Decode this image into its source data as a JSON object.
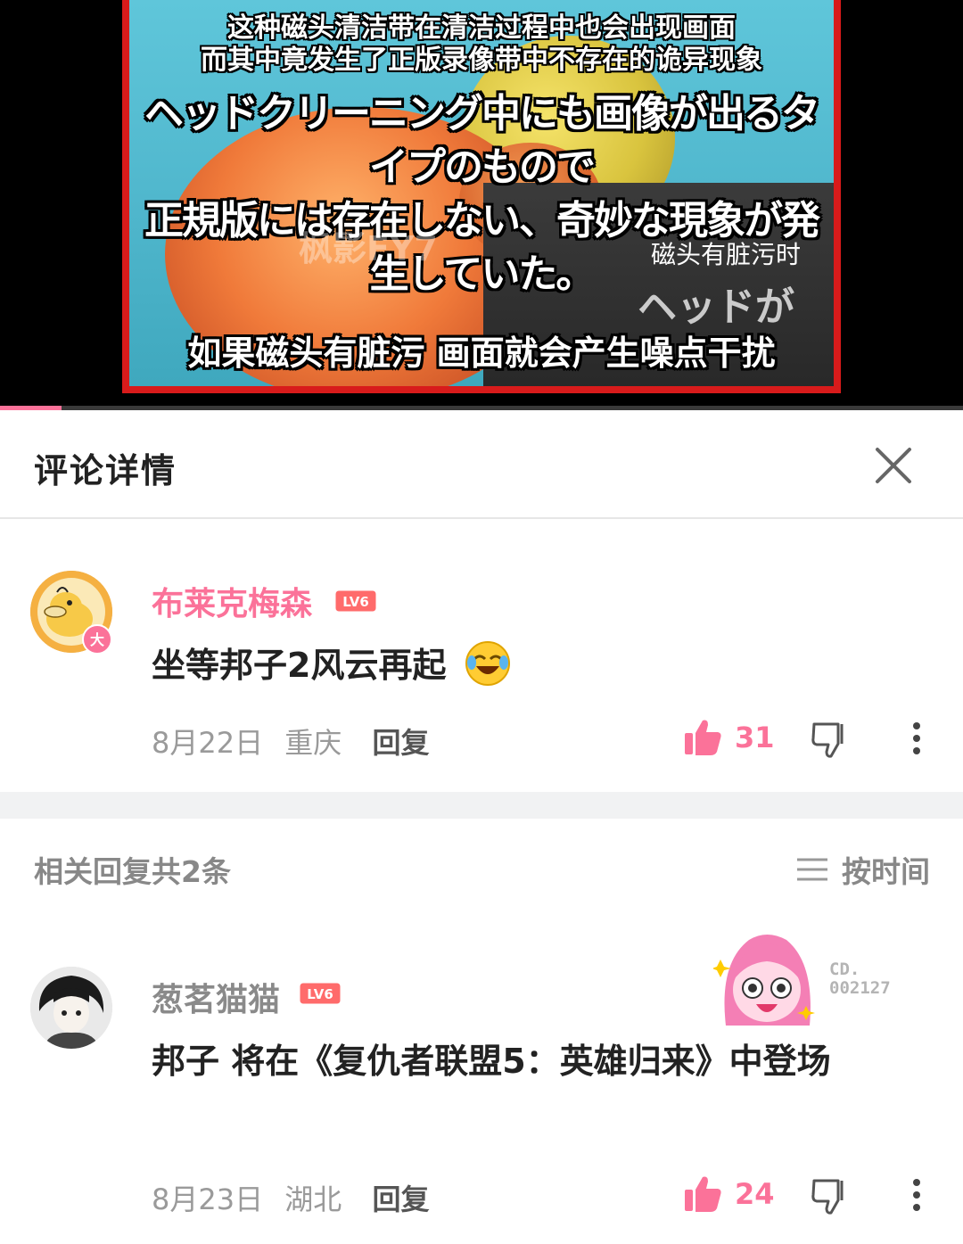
{
  "video": {
    "subtitle_cn_top_line1": "这种磁头清洁带在清洁过程中也会出现画面",
    "subtitle_cn_top_line2": "而其中竟发生了正版录像带中不存在的诡异现象",
    "subtitle_jp_line1": "ヘッドクリーニング中にも画像が出るタイプのもので",
    "subtitle_jp_line2": "正規版には存在しない、奇妙な現象が発生していた。",
    "watermark": "枫影FY7",
    "caption_small": "磁头有脏污时",
    "caption_jp": "ヘッドが",
    "subtitle_cn_bottom": "如果磁头有脏污 画面就会产生噪点干扰",
    "progress": 0.064,
    "progress_color": "#fb7299"
  },
  "header": {
    "title": "评论详情",
    "close_icon": "close-icon"
  },
  "main_comment": {
    "username": "布莱克梅森",
    "username_color": "#fb7299",
    "level": "LV6",
    "avatar_badge": "大",
    "text": "坐等邦子2风云再起",
    "emoji": "laughing-crying-emoji",
    "date": "8月22日",
    "location": "重庆",
    "reply_label": "回复",
    "like_count": "31"
  },
  "replies_section": {
    "count_label": "相关回复共2条",
    "sort_label": "按时间",
    "sort_icon": "menu-lines-icon"
  },
  "reply": {
    "username": "葱茗猫猫",
    "username_color": "#8a8a8a",
    "level": "LV6",
    "text": "邦子 将在《复仇者联盟5：英雄归来》中登场",
    "date": "8月23日",
    "location": "湖北",
    "reply_label": "回复",
    "like_count": "24",
    "decor_code_line1": "CD.",
    "decor_code_line2": "002127"
  },
  "colors": {
    "accent_pink": "#fb7299",
    "frame_red": "#d81b1b",
    "divider_gray": "#f1f2f3"
  }
}
